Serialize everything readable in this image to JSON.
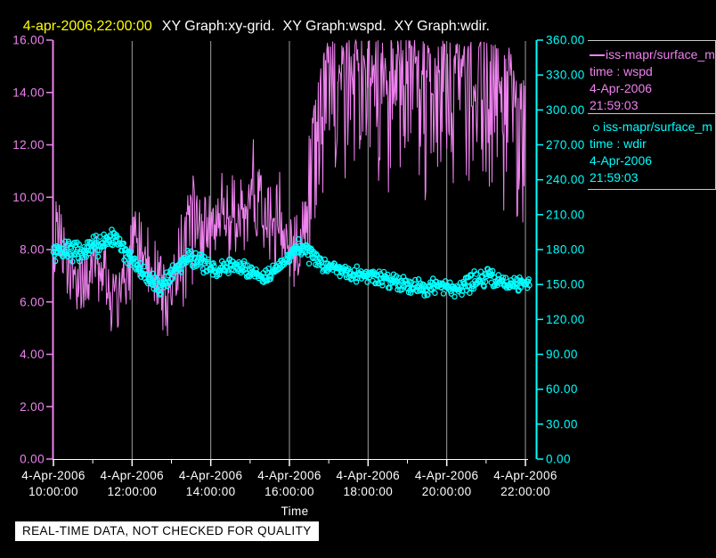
{
  "header": {
    "timestamp": "4-apr-2006,22:00:00",
    "titles": "XY Graph:xy-grid.  XY Graph:wspd.  XY Graph:wdir."
  },
  "footer": {
    "quality_notice": "REAL-TIME DATA, NOT CHECKED FOR QUALITY"
  },
  "legend": {
    "entries": [
      {
        "symbol": "line",
        "name": "iss-mapr/surface_m",
        "field": "time : wspd",
        "date": "4-Apr-2006",
        "time": "21:59:03",
        "color": "#ee82ee"
      },
      {
        "symbol": "circle",
        "name": "iss-mapr/surface_m",
        "field": "time : wdir",
        "date": "4-Apr-2006",
        "time": "21:59:03",
        "color": "#00ffff"
      }
    ]
  },
  "colors": {
    "background": "#000000",
    "wspd": "#ee82ee",
    "wdir": "#00ffff",
    "grid": "#a0a0a0",
    "time_axis": "#ffffff",
    "title_time": "#ffff00",
    "title_text": "#ffffff"
  },
  "chart_data": {
    "type": "line",
    "xlabel": "Time",
    "grid": {
      "vertical_hours": [
        12,
        14,
        16,
        18,
        20,
        22
      ],
      "horizontal": false
    },
    "x_axis": {
      "range_hours": [
        10,
        22
      ],
      "minor_tick_hours": [
        11,
        13,
        15,
        17,
        19,
        21
      ],
      "major_ticks": [
        {
          "hour": 10,
          "date": "4-Apr-2006",
          "time": "10:00:00"
        },
        {
          "hour": 12,
          "date": "4-Apr-2006",
          "time": "12:00:00"
        },
        {
          "hour": 14,
          "date": "4-Apr-2006",
          "time": "14:00:00"
        },
        {
          "hour": 16,
          "date": "4-Apr-2006",
          "time": "16:00:00"
        },
        {
          "hour": 18,
          "date": "4-Apr-2006",
          "time": "18:00:00"
        },
        {
          "hour": 20,
          "date": "4-Apr-2006",
          "time": "20:00:00"
        },
        {
          "hour": 22,
          "date": "4-Apr-2006",
          "time": "22:00:00"
        }
      ]
    },
    "left_axis": {
      "series": "wspd",
      "range": [
        0,
        16
      ],
      "color": "#ee82ee",
      "ticks": [
        "16.00",
        "14.00",
        "12.00",
        "10.00",
        "8.00",
        "6.00",
        "4.00",
        "2.00",
        "0.00"
      ]
    },
    "right_axis": {
      "series": "wdir",
      "range": [
        0,
        360
      ],
      "color": "#00ffff",
      "ticks": [
        "360.00",
        "330.00",
        "300.00",
        "270.00",
        "240.00",
        "210.00",
        "180.00",
        "150.00",
        "120.00",
        "90.00",
        "60.00",
        "30.00",
        "0.00"
      ]
    },
    "series": [
      {
        "name": "wspd",
        "type": "line",
        "axis": "left",
        "color": "#ee82ee",
        "description": "1-min wind speed, very noisy; envelope keyframes [hour, min, max] (m/s) read from plot",
        "envelope_keyframes": [
          [
            10.0,
            6.3,
            9.6
          ],
          [
            10.1,
            6.8,
            10.3
          ],
          [
            10.3,
            6.0,
            9.2
          ],
          [
            10.5,
            5.4,
            8.8
          ],
          [
            10.7,
            4.8,
            8.2
          ],
          [
            10.85,
            5.2,
            8.6
          ],
          [
            11.0,
            5.6,
            9.4
          ],
          [
            11.2,
            5.2,
            8.8
          ],
          [
            11.45,
            4.5,
            8.3
          ],
          [
            11.65,
            4.3,
            8.0
          ],
          [
            11.9,
            5.2,
            8.8
          ],
          [
            12.05,
            6.2,
            10.0
          ],
          [
            12.2,
            6.0,
            10.7
          ],
          [
            12.4,
            5.4,
            9.4
          ],
          [
            12.6,
            4.8,
            8.8
          ],
          [
            12.8,
            4.6,
            8.2
          ],
          [
            13.0,
            4.5,
            8.6
          ],
          [
            13.15,
            4.4,
            9.0
          ],
          [
            13.35,
            5.6,
            11.0
          ],
          [
            13.5,
            6.2,
            13.2
          ],
          [
            13.65,
            6.6,
            11.8
          ],
          [
            13.85,
            6.8,
            10.6
          ],
          [
            14.05,
            7.0,
            10.2
          ],
          [
            14.25,
            6.8,
            12.2
          ],
          [
            14.45,
            6.6,
            11.2
          ],
          [
            14.7,
            6.8,
            10.8
          ],
          [
            14.9,
            7.0,
            12.0
          ],
          [
            15.1,
            7.2,
            13.8
          ],
          [
            15.3,
            6.9,
            11.6
          ],
          [
            15.5,
            6.6,
            11.0
          ],
          [
            15.7,
            6.3,
            11.8
          ],
          [
            15.9,
            6.5,
            10.4
          ],
          [
            16.05,
            6.2,
            9.8
          ],
          [
            16.2,
            5.6,
            9.4
          ],
          [
            16.35,
            6.6,
            11.0
          ],
          [
            16.55,
            8.0,
            12.8
          ],
          [
            16.75,
            9.2,
            14.6
          ],
          [
            16.95,
            10.4,
            16.0
          ],
          [
            17.2,
            11.0,
            16.0
          ],
          [
            17.45,
            10.2,
            16.0
          ],
          [
            17.7,
            11.2,
            16.0
          ],
          [
            17.95,
            11.6,
            16.0
          ],
          [
            18.2,
            10.8,
            16.0
          ],
          [
            18.45,
            8.6,
            16.0
          ],
          [
            18.7,
            9.6,
            16.0
          ],
          [
            18.95,
            11.4,
            16.0
          ],
          [
            19.2,
            10.8,
            16.0
          ],
          [
            19.45,
            9.8,
            16.0
          ],
          [
            19.7,
            11.2,
            16.0
          ],
          [
            19.95,
            11.0,
            16.0
          ],
          [
            20.2,
            10.4,
            16.0
          ],
          [
            20.45,
            10.8,
            15.8
          ],
          [
            20.7,
            9.9,
            16.0
          ],
          [
            20.95,
            10.6,
            16.0
          ],
          [
            21.2,
            10.2,
            15.8
          ],
          [
            21.45,
            9.4,
            16.0
          ],
          [
            21.7,
            10.4,
            15.6
          ],
          [
            21.85,
            6.4,
            15.0
          ],
          [
            22.0,
            9.8,
            14.2
          ]
        ]
      },
      {
        "name": "wdir",
        "type": "scatter",
        "axis": "right",
        "color": "#00ffff",
        "description": "1-min wind direction scatter; band keyframes [hour, center_deg, spread_deg] read from plot",
        "band_keyframes": [
          [
            10.0,
            176,
            11
          ],
          [
            10.35,
            181,
            13
          ],
          [
            10.7,
            177,
            10
          ],
          [
            11.0,
            182,
            11
          ],
          [
            11.3,
            188,
            11
          ],
          [
            11.6,
            191,
            9
          ],
          [
            11.85,
            176,
            9
          ],
          [
            12.1,
            166,
            9
          ],
          [
            12.4,
            156,
            9
          ],
          [
            12.7,
            147,
            9
          ],
          [
            12.95,
            157,
            9
          ],
          [
            13.2,
            166,
            9
          ],
          [
            13.45,
            176,
            11
          ],
          [
            13.7,
            170,
            9
          ],
          [
            13.95,
            164,
            8
          ],
          [
            14.2,
            162,
            8
          ],
          [
            14.5,
            167,
            9
          ],
          [
            14.8,
            164,
            8
          ],
          [
            15.05,
            161,
            8
          ],
          [
            15.3,
            157,
            8
          ],
          [
            15.6,
            162,
            8
          ],
          [
            15.85,
            168,
            9
          ],
          [
            16.1,
            180,
            10
          ],
          [
            16.35,
            182,
            9
          ],
          [
            16.6,
            172,
            8
          ],
          [
            16.9,
            167,
            8
          ],
          [
            17.2,
            164,
            8
          ],
          [
            17.5,
            161,
            8
          ],
          [
            17.8,
            159,
            8
          ],
          [
            18.1,
            157,
            8
          ],
          [
            18.4,
            155,
            8
          ],
          [
            18.7,
            153,
            9
          ],
          [
            19.0,
            151,
            9
          ],
          [
            19.3,
            147,
            10
          ],
          [
            19.6,
            149,
            10
          ],
          [
            19.9,
            147,
            10
          ],
          [
            20.2,
            146,
            10
          ],
          [
            20.5,
            151,
            10
          ],
          [
            20.8,
            154,
            10
          ],
          [
            21.1,
            156,
            9
          ],
          [
            21.4,
            152,
            8
          ],
          [
            21.7,
            150,
            8
          ],
          [
            22.1,
            153,
            7
          ]
        ]
      }
    ]
  }
}
